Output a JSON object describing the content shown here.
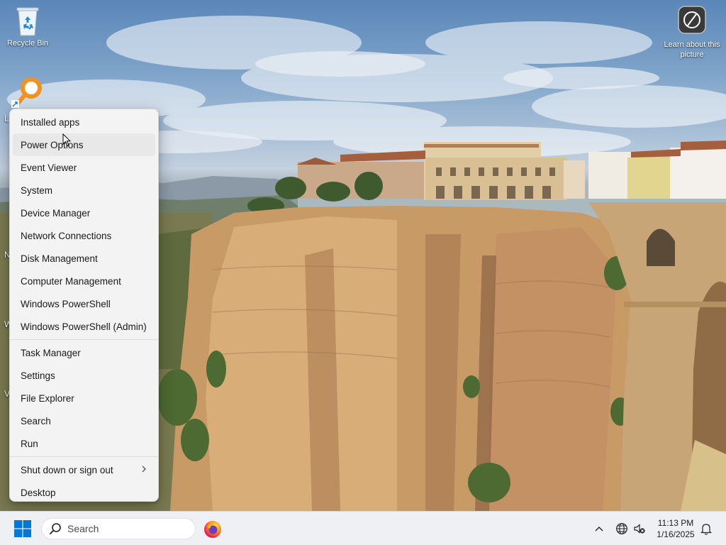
{
  "desktop": {
    "icons": [
      {
        "label": "Recycle Bin"
      },
      {
        "label": "Learn about this picture"
      }
    ]
  },
  "context_menu": {
    "groups": [
      {
        "items": [
          {
            "label": "Installed apps"
          },
          {
            "label": "Power Options",
            "hovered": true
          },
          {
            "label": "Event Viewer"
          },
          {
            "label": "System"
          },
          {
            "label": "Device Manager"
          },
          {
            "label": "Network Connections"
          },
          {
            "label": "Disk Management"
          },
          {
            "label": "Computer Management"
          },
          {
            "label": "Windows PowerShell"
          },
          {
            "label": "Windows PowerShell (Admin)"
          }
        ]
      },
      {
        "items": [
          {
            "label": "Task Manager"
          },
          {
            "label": "Settings"
          },
          {
            "label": "File Explorer"
          },
          {
            "label": "Search"
          },
          {
            "label": "Run"
          }
        ]
      },
      {
        "items": [
          {
            "label": "Shut down or sign out",
            "has_submenu": true
          },
          {
            "label": "Desktop"
          }
        ]
      }
    ]
  },
  "taskbar": {
    "search_placeholder": "Search",
    "pinned": [
      "firefox-icon"
    ],
    "clock": {
      "time": "11:13 PM",
      "date": "1/16/2025"
    }
  },
  "colors": {
    "accent": "#0078d4",
    "menu_bg": "#f3f3f3",
    "taskbar_bg": "#eef0f3",
    "menu_hover": "#e8e8e8"
  }
}
